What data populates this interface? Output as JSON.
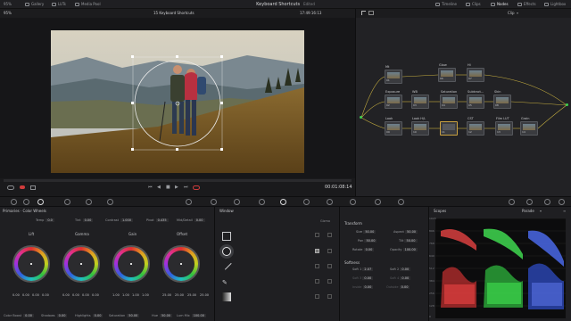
{
  "topbar": {
    "zoom": "95%",
    "left_items": [
      "Gallery",
      "LUTs",
      "Media Pool"
    ],
    "title": "Keyboard Shortcuts",
    "edited": "Edited",
    "right_items": [
      "Timeline",
      "Clips",
      "Nodes",
      "Effects",
      "Lightbox"
    ]
  },
  "viewer": {
    "clip_title": "15 Keyboard Shortcuts",
    "timecode": "17:49:16:13",
    "current_timecode": "00:01:08:14"
  },
  "nodes_bar": {
    "mode": "Clip"
  },
  "nodes": [
    {
      "label": "Mt",
      "num": "01"
    },
    {
      "label": "Glow",
      "num": "06"
    },
    {
      "label": "Hi",
      "num": "07"
    },
    {
      "label": "Exposure",
      "num": "02"
    },
    {
      "label": "WB",
      "num": "03"
    },
    {
      "label": "Saturation",
      "num": "04"
    },
    {
      "label": "Subtract...",
      "num": "05"
    },
    {
      "label": "Skin",
      "num": "08"
    },
    {
      "label": "Look",
      "num": "09"
    },
    {
      "label": "Look H/L",
      "num": "10"
    },
    {
      "label": "",
      "num": "11"
    },
    {
      "label": "CST",
      "num": "12"
    },
    {
      "label": "Film LUT",
      "num": "13"
    },
    {
      "label": "Grain",
      "num": "14"
    }
  ],
  "primaries": {
    "title": "Primaries · Color Wheels",
    "temp_label": "Temp",
    "temp": "0.0",
    "tint_label": "Tint",
    "tint": "0.00",
    "contrast_label": "Contrast",
    "contrast": "1.000",
    "pivot_label": "Pivot",
    "pivot": "0.435",
    "middetail_label": "Mid/Detail",
    "middetail": "0.00",
    "wheels": [
      {
        "name": "Lift",
        "vals": [
          "0.00",
          "0.00",
          "0.00",
          "0.00"
        ]
      },
      {
        "name": "Gamma",
        "vals": [
          "0.00",
          "0.00",
          "0.00",
          "0.00"
        ]
      },
      {
        "name": "Gain",
        "vals": [
          "1.00",
          "1.00",
          "1.00",
          "1.00"
        ]
      },
      {
        "name": "Offset",
        "vals": [
          "25.00",
          "25.00",
          "25.00",
          "25.00"
        ]
      }
    ],
    "color_boost_label": "Color Boost",
    "color_boost": "0.00",
    "shadows_label": "Shadows",
    "shadows": "0.00",
    "highlights_label": "Highlights",
    "highlights": "0.00",
    "saturation_label": "Saturation",
    "saturation": "50.00",
    "hue_label": "Hue",
    "hue": "50.00",
    "lummix_label": "Lum Mix",
    "lummix": "100.00"
  },
  "window_panel": {
    "title": "Window",
    "shapes_label": "Gizmo"
  },
  "transform": {
    "title": "Transform",
    "size_label": "Size",
    "size": "50.00",
    "aspect_label": "Aspect",
    "aspect": "50.00",
    "pan_label": "Pan",
    "pan": "50.00",
    "tilt_label": "Tilt",
    "tilt": "50.00",
    "rotate_label": "Rotate",
    "rotate": "0.00",
    "opacity_label": "Opacity",
    "opacity": "100.00",
    "softness_title": "Softness",
    "soft1_label": "Soft 1",
    "soft1": "2.07",
    "soft3_label": "Soft 3",
    "soft3": "0.00",
    "inside_label": "Inside",
    "inside": "0.00",
    "soft2_label": "Soft 2",
    "soft2": "0.00",
    "soft4_label": "Soft 4",
    "soft4": "0.00",
    "outside_label": "Outside",
    "outside": "0.00"
  },
  "scopes": {
    "title": "Scopes",
    "mode": "Parade",
    "scale": [
      "1023",
      "896",
      "768",
      "640",
      "512",
      "384",
      "256",
      "128",
      "0"
    ]
  },
  "colors": {
    "accent": "#e0a030",
    "red": "#d03c3c",
    "green": "#3cd050",
    "blue": "#4060e0"
  }
}
